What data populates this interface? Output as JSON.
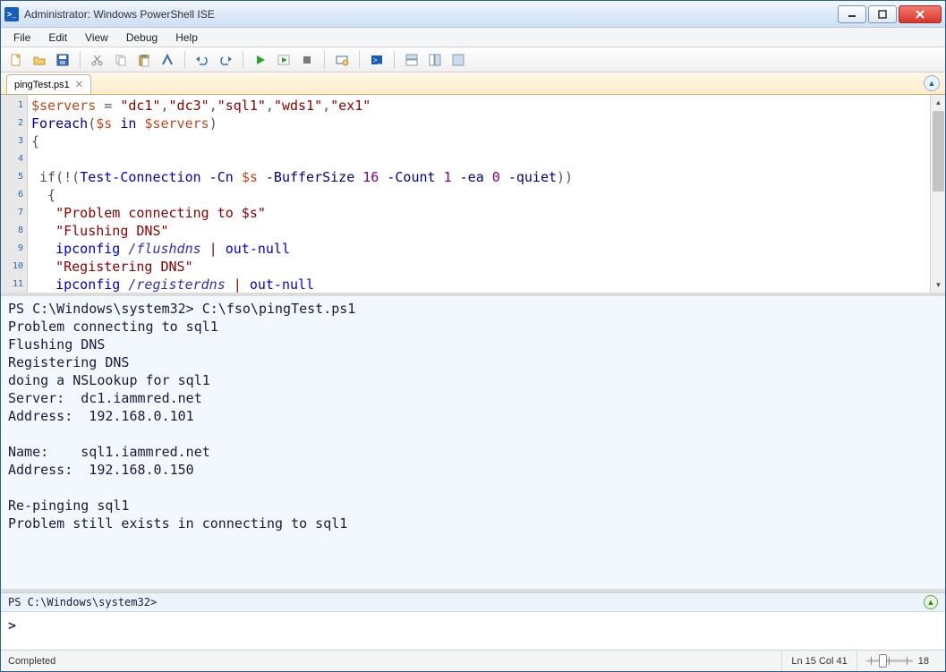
{
  "titlebar": {
    "title": "Administrator: Windows PowerShell ISE"
  },
  "menu": {
    "file": "File",
    "edit": "Edit",
    "view": "View",
    "debug": "Debug",
    "help": "Help"
  },
  "tab": {
    "name": "pingTest.ps1"
  },
  "editor": {
    "line_numbers": [
      "1",
      "2",
      "3",
      "4",
      "5",
      "6",
      "7",
      "8",
      "9",
      "10",
      "11"
    ],
    "l1_var": "$servers",
    "l1_eq": " = ",
    "l1_s1": "\"dc1\"",
    "l1_c1": ",",
    "l1_s2": "\"dc3\"",
    "l1_c2": ",",
    "l1_s3": "\"sql1\"",
    "l1_c3": ",",
    "l1_s4": "\"wds1\"",
    "l1_c4": ",",
    "l1_s5": "\"ex1\"",
    "l2_kw": "Foreach",
    "l2_open": "(",
    "l2_s": "$s",
    "l2_in": " in ",
    "l2_srv": "$servers",
    "l2_close": ")",
    "l3": "{",
    "l5_pre": " if(!(",
    "l5_cmd": "Test-Connection",
    "l5_p1": " -Cn ",
    "l5_a1": "$s",
    "l5_p2": " -BufferSize ",
    "l5_a2": "16",
    "l5_p3": " -Count ",
    "l5_a3": "1",
    "l5_p4": " -ea ",
    "l5_a4": "0",
    "l5_p5": " -quiet",
    "l5_post": "))",
    "l6": "  {",
    "l7": "   \"Problem connecting to $s\"",
    "l8": "   \"Flushing DNS\"",
    "l9_indent": "   ",
    "l9_cmd": "ipconfig",
    "l9_arg": " /flushdns",
    "l9_pipe": " | ",
    "l9_out": "out-null",
    "l10": "   \"Registering DNS\"",
    "l11_indent": "   ",
    "l11_cmd": "ipconfig",
    "l11_arg": " /registerdns",
    "l11_pipe": " | ",
    "l11_out": "out-null"
  },
  "output": "PS C:\\Windows\\system32> C:\\fso\\pingTest.ps1\nProblem connecting to sql1\nFlushing DNS\nRegistering DNS\ndoing a NSLookup for sql1\nServer:  dc1.iammred.net\nAddress:  192.168.0.101\n\nName:    sql1.iammred.net\nAddress:  192.168.0.150\n\nRe-pinging sql1\nProblem still exists in connecting to sql1\n\n",
  "cmd": {
    "prompt": "PS C:\\Windows\\system32>",
    "input": ">"
  },
  "status": {
    "left": "Completed",
    "pos": "Ln 15  Col 41",
    "zoom": "18"
  }
}
